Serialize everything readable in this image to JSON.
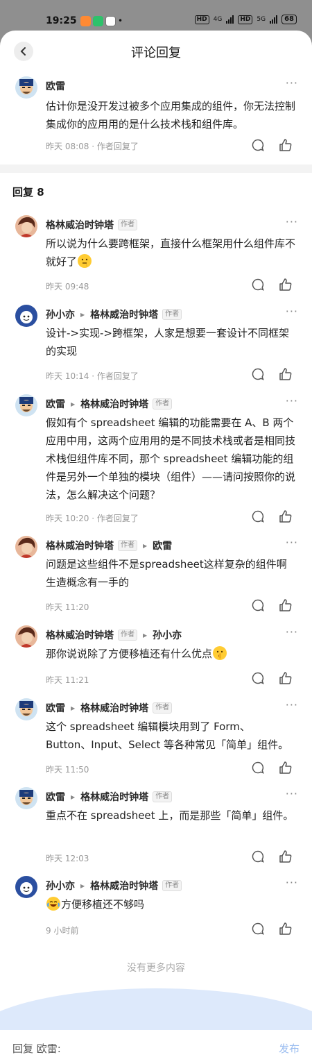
{
  "status_bar": {
    "time": "19:25",
    "hd1": "HD",
    "net1": "4G",
    "hd2": "HD",
    "net2": "5G",
    "battery": "68"
  },
  "header": {
    "title": "评论回复"
  },
  "main_comment": {
    "user": "欧雷",
    "text": "估计你是没开发过被多个应用集成的组件，你无法控制集成你的应用用的是什么技术栈和组件库。",
    "time": "昨天 08:08 · 作者回复了"
  },
  "replies_header": "回复 8",
  "author_tag": "作者",
  "replies": [
    {
      "user": "格林威治时钟塔",
      "text": "所以说为什么要跨框架，直接什么框架用什么组件库不就好了",
      "time": "昨天 09:48"
    },
    {
      "user": "孙小亦",
      "to": "格林威治时钟塔",
      "text": "设计->实现->跨框架，人家是想要一套设计不同框架的实现",
      "time": "昨天 10:14 · 作者回复了"
    },
    {
      "user": "欧雷",
      "to": "格林威治时钟塔",
      "text": "假如有个 spreadsheet 编辑的功能需要在 A、B 两个应用中用，这两个应用用的是不同技术栈或者是相同技术栈但组件库不同，那个 spreadsheet 编辑功能的组件是另外一个单独的模块（组件）——请问按照你的说法，怎么解决这个问题？",
      "time": "昨天 10:20 · 作者回复了"
    },
    {
      "user": "格林威治时钟塔",
      "to": "欧雷",
      "text": "问题是这些组件不是spreadsheet这样复杂的组件啊生造概念有一手的",
      "time": "昨天 11:20"
    },
    {
      "user": "格林威治时钟塔",
      "to": "孙小亦",
      "text": "那你说说除了方便移植还有什么优点",
      "time": "昨天 11:21"
    },
    {
      "user": "欧雷",
      "to": "格林威治时钟塔",
      "text": "这个 spreadsheet 编辑模块用到了 Form、Button、Input、Select 等各种常见「简单」组件。",
      "time": "昨天 11:50"
    },
    {
      "user": "欧雷",
      "to": "格林威治时钟塔",
      "text": "重点不在 spreadsheet 上，而是那些「简单」组件。",
      "time": "昨天 12:03"
    },
    {
      "user": "孙小亦",
      "to": "格林威治时钟塔",
      "text": "方便移植还不够吗",
      "time": "9 小时前"
    }
  ],
  "footer": {
    "no_more": "没有更多内容",
    "reply_placeholder": "回复 欧雷:",
    "publish": "发布"
  },
  "colors": {
    "accent": "#9bbdf0",
    "divider": "#f3f3f3",
    "wave": "#dde9fb"
  }
}
